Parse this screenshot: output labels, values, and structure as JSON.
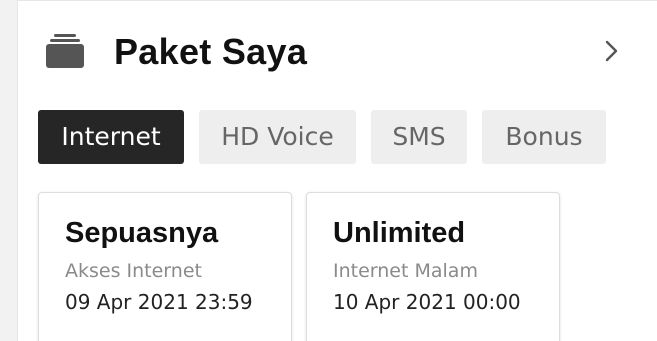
{
  "header": {
    "title": "Paket Saya",
    "icon": "stack-icon",
    "nav_icon": "chevron-right-icon"
  },
  "tabs": [
    {
      "label": "Internet",
      "active": true
    },
    {
      "label": "HD Voice",
      "active": false
    },
    {
      "label": "SMS",
      "active": false
    },
    {
      "label": "Bonus",
      "active": false
    }
  ],
  "cards": [
    {
      "title": "Sepuasnya",
      "subtitle": "Akses Internet",
      "expiry": "09 Apr 2021 23:59"
    },
    {
      "title": "Unlimited",
      "subtitle": "Internet Malam",
      "expiry": "10 Apr 2021 00:00"
    }
  ],
  "colors": {
    "active_tab_bg": "#262626",
    "inactive_tab_bg": "#eeeeee",
    "title_text": "#111111",
    "muted_text": "#8a8a8a"
  }
}
